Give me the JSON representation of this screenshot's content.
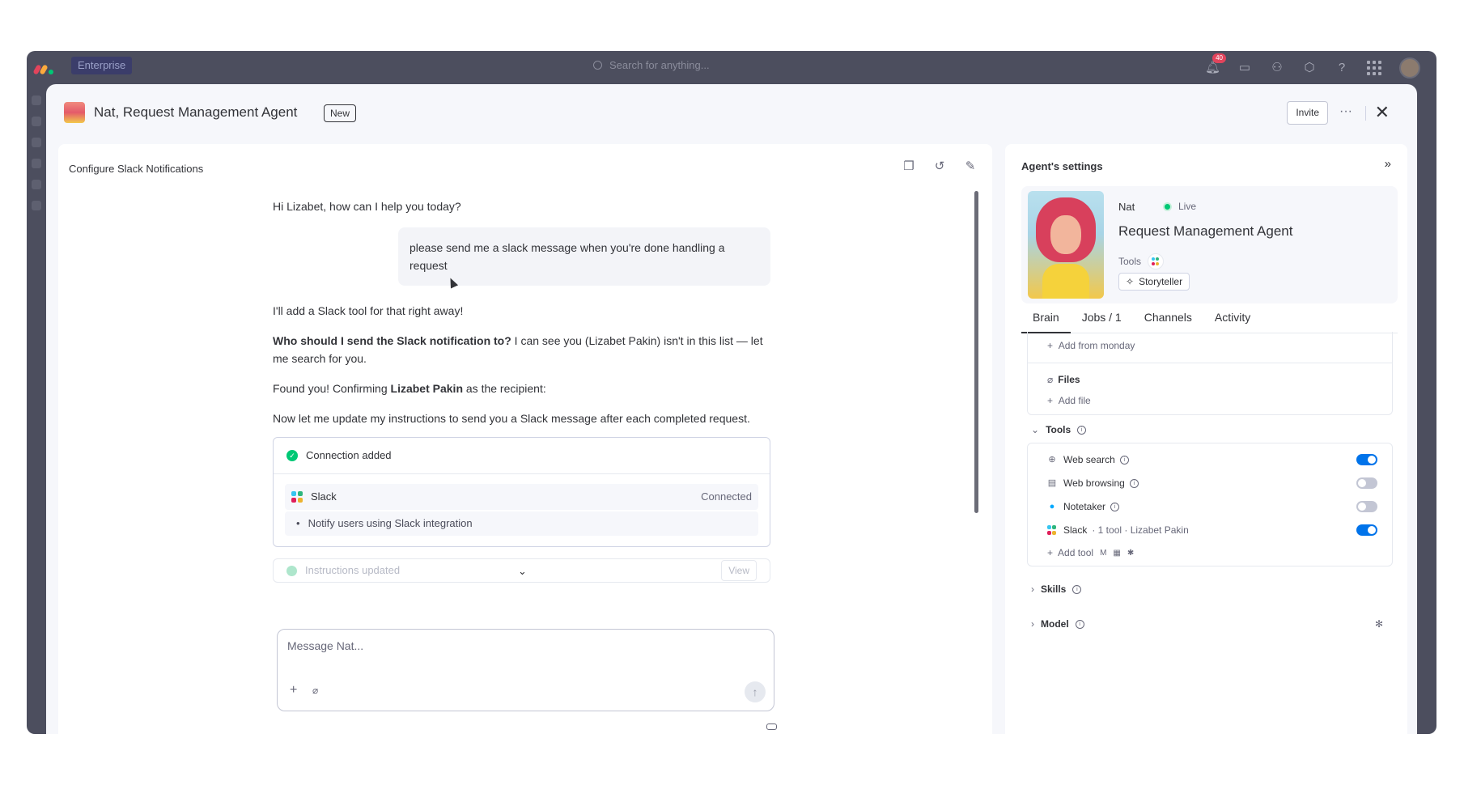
{
  "topbar": {
    "plan_badge": "Enterprise",
    "search_placeholder": "Search for anything...",
    "notification_count": "40"
  },
  "modal": {
    "title": "Nat, Request Management Agent",
    "new_tag": "New",
    "invite_label": "Invite",
    "more_label": "···",
    "close_label": "✕"
  },
  "chat": {
    "title": "Configure Slack Notifications",
    "greeting": "Hi Lizabet, how can I help you today?",
    "user_message": "please send me a slack message when you're done handling a request",
    "reply_1": "I'll add a Slack tool for that right away!",
    "reply_2_bold": "Who should I send the Slack notification to?",
    "reply_2_rest": " I can see you (Lizabet Pakin) isn't in this list — let me search for you.",
    "reply_3_pre": "Found you! Confirming ",
    "reply_3_bold": "Lizabet Pakin",
    "reply_3_post": " as the recipient:",
    "reply_4": "Now let me update my instructions to send you a Slack message after each completed request.",
    "connection_card": {
      "header": "Connection added",
      "app": "Slack",
      "status": "Connected",
      "detail": "Notify users using Slack integration"
    },
    "instructions_card": {
      "header": "Instructions updated",
      "view_label": "View"
    },
    "input_placeholder": "Message Nat..."
  },
  "settings": {
    "title": "Agent's settings",
    "agent_name": "Nat",
    "status": "Live",
    "role": "Request Management Agent",
    "tools_label": "Tools",
    "skill_tag": "Storyteller",
    "tabs": [
      "Brain",
      "Jobs / 1",
      "Channels",
      "Activity"
    ],
    "brain": {
      "add_from": "Add from monday",
      "files_label": "Files",
      "add_file": "Add file"
    },
    "tools_section": {
      "header": "Tools",
      "items": [
        {
          "name": "Web search",
          "enabled": true
        },
        {
          "name": "Web browsing",
          "enabled": false
        },
        {
          "name": "Notetaker",
          "enabled": false
        },
        {
          "name": "Slack",
          "detail": "· 1 tool · Lizabet Pakin",
          "enabled": true
        }
      ],
      "add_tool": "Add tool"
    },
    "skills_header": "Skills",
    "model_header": "Model"
  },
  "colors": {
    "accent": "#0073ea",
    "success": "#00c875",
    "frame": "#4c4e5e"
  }
}
